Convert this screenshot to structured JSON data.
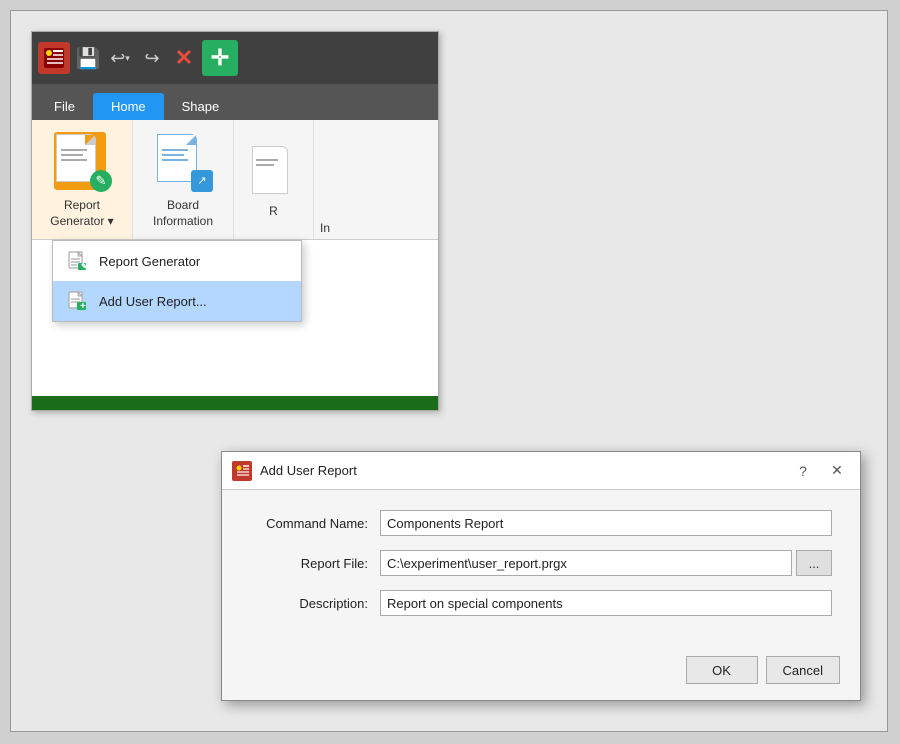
{
  "app": {
    "toolbar": {
      "save_icon": "💾",
      "undo_icon": "↩",
      "undo_dropdown": "▾",
      "redo_icon": "↪",
      "delete_icon": "✕",
      "cross_icon": "✛"
    },
    "menu_tabs": [
      {
        "label": "File",
        "active": false
      },
      {
        "label": "Home",
        "active": true
      },
      {
        "label": "Shape",
        "active": false
      }
    ],
    "ribbon": {
      "items": [
        {
          "label": "Report\nGenerator ▾",
          "label_line1": "Report",
          "label_line2": "Generator ▾",
          "active": true
        },
        {
          "label": "Board\nInformation",
          "label_line1": "Board",
          "label_line2": "Information",
          "active": false
        },
        {
          "label": "R",
          "partial": true
        }
      ]
    },
    "dropdown": {
      "items": [
        {
          "label": "Report Generator",
          "selected": false
        },
        {
          "label": "Add User Report...",
          "selected": true
        }
      ]
    },
    "partial_visible": "In"
  },
  "dialog": {
    "title": "Add User Report",
    "title_icon": "★",
    "help_btn": "?",
    "close_btn": "✕",
    "fields": {
      "command_name": {
        "label": "Command Name:",
        "value": "Components Report",
        "placeholder": ""
      },
      "report_file": {
        "label": "Report File:",
        "value": "C:\\experiment\\user_report.prgx",
        "browse_label": "..."
      },
      "description": {
        "label": "Description:",
        "value": "Report on special components",
        "placeholder": ""
      }
    },
    "buttons": {
      "ok": "OK",
      "cancel": "Cancel"
    }
  }
}
